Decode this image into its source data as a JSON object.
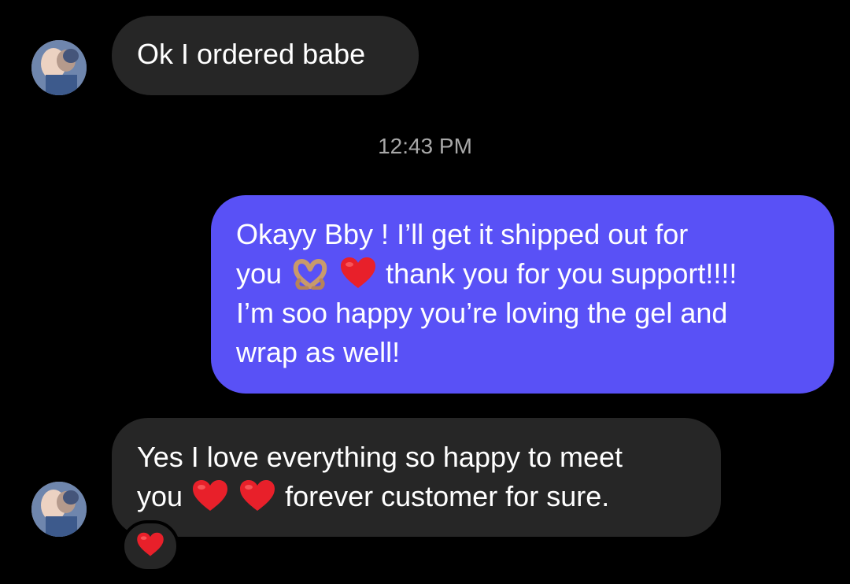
{
  "thread": {
    "timestamp": "12:43 PM",
    "messages": [
      {
        "sender": "other",
        "lines": [
          "Ok I ordered babe"
        ]
      },
      {
        "sender": "me",
        "line1": "Okayy Bby ! I’ll get it shipped out for",
        "line2_before": "you",
        "line2_after": "thank you for you support!!!!",
        "line3": "I’m soo happy you’re loving the gel and",
        "line4": "wrap as well!",
        "emojis": [
          "heart-hands-icon",
          "red-heart-icon"
        ]
      },
      {
        "sender": "other",
        "line1": "Yes I love everything so happy to meet",
        "line2_before": "you",
        "line2_after": "forever customer for sure.",
        "emojis": [
          "red-heart-icon",
          "red-heart-icon"
        ],
        "reaction": "red-heart-icon"
      }
    ]
  },
  "colors": {
    "background": "#000000",
    "incoming_bubble": "#262626",
    "outgoing_bubble": "#5951f6",
    "timestamp": "#a8a8a8",
    "heart": "#e8202a"
  }
}
